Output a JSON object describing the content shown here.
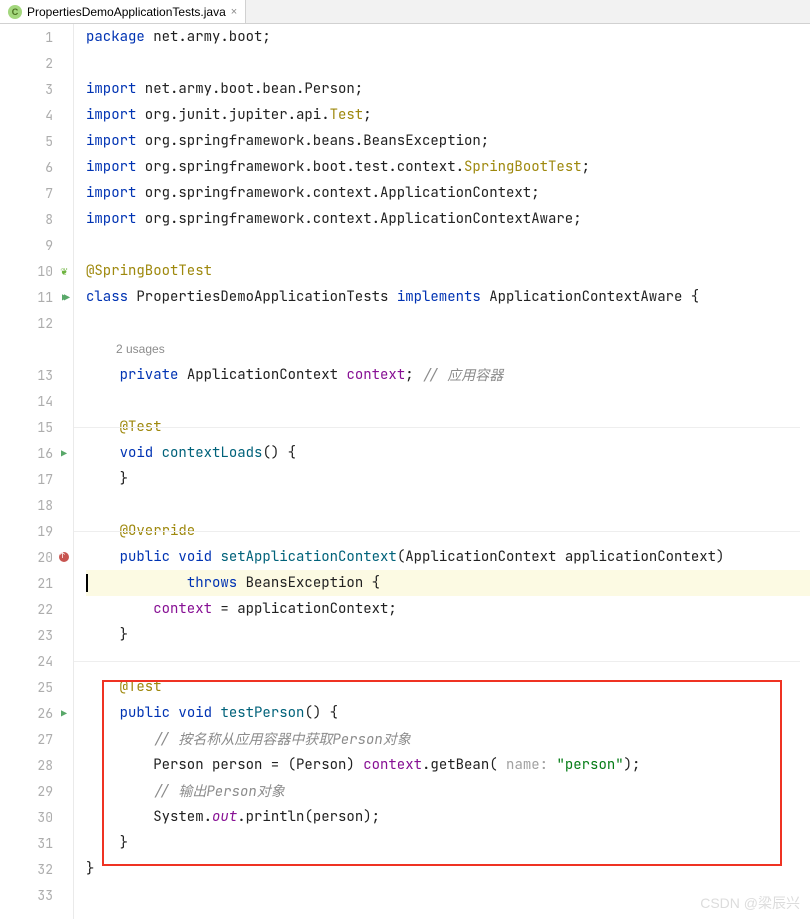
{
  "tab": {
    "filename": "PropertiesDemoApplicationTests.java",
    "close": "×"
  },
  "gutter": {
    "lines": [
      "1",
      "2",
      "3",
      "4",
      "5",
      "6",
      "7",
      "8",
      "9",
      "10",
      "11",
      "12",
      "",
      "13",
      "14",
      "15",
      "16",
      "17",
      "18",
      "19",
      "20",
      "21",
      "22",
      "23",
      "24",
      "25",
      "26",
      "27",
      "28",
      "29",
      "30",
      "31",
      "32",
      "33"
    ]
  },
  "code": {
    "l1": {
      "kw": "package",
      "rest": " net.army.boot;"
    },
    "l3": {
      "kw": "import",
      "rest": " net.army.boot.bean.Person;"
    },
    "l4": {
      "kw": "import",
      "p1": " org.junit.jupiter.api.",
      "cls": "Test",
      "semi": ";"
    },
    "l5": {
      "kw": "import",
      "rest": " org.springframework.beans.BeansException;"
    },
    "l6": {
      "kw": "import",
      "p1": " org.springframework.boot.test.context.",
      "cls": "SpringBootTest",
      "semi": ";"
    },
    "l7": {
      "kw": "import",
      "rest": " org.springframework.context.ApplicationContext;"
    },
    "l8": {
      "kw": "import",
      "rest": " org.springframework.context.ApplicationContextAware;"
    },
    "l10": {
      "ann": "@SpringBootTest"
    },
    "l11": {
      "kw1": "class",
      "name": " PropertiesDemoApplicationTests ",
      "kw2": "implements",
      "rest": " ApplicationContextAware {"
    },
    "usages": "2 usages",
    "l13": {
      "pad": "    ",
      "kw": "private",
      "sp": " ",
      "type": "ApplicationContext ",
      "field": "context",
      "semi": "; ",
      "comment": "// 应用容器"
    },
    "l15": {
      "pad": "    ",
      "ann": "@Test"
    },
    "l16": {
      "pad": "    ",
      "kw": "void",
      "sp": " ",
      "method": "contextLoads",
      "rest": "() {"
    },
    "l17": {
      "pad": "    ",
      "brace": "}"
    },
    "l19": {
      "pad": "    ",
      "ann": "@Override"
    },
    "l20": {
      "pad": "    ",
      "kw1": "public",
      "sp1": " ",
      "kw2": "void",
      "sp2": " ",
      "method": "setApplicationContext",
      "rest": "(ApplicationContext applicationContext)"
    },
    "l21": {
      "pad": "            ",
      "kw": "throws",
      "rest": " BeansException {"
    },
    "l22": {
      "pad": "        ",
      "field": "context",
      "rest": " = applicationContext;"
    },
    "l23": {
      "pad": "    ",
      "brace": "}"
    },
    "l25": {
      "pad": "    ",
      "ann": "@Test"
    },
    "l26": {
      "pad": "    ",
      "kw1": "public",
      "sp1": " ",
      "kw2": "void",
      "sp2": " ",
      "method": "testPerson",
      "rest": "() {"
    },
    "l27": {
      "pad": "        ",
      "comment": "// 按名称从应用容器中获取Person对象"
    },
    "l28": {
      "pad": "        ",
      "p1": "Person person = (Person) ",
      "field": "context",
      "dot": ".",
      "method": "getBean",
      "open": "( ",
      "hint": "name: ",
      "str": "\"person\"",
      "close": ");"
    },
    "l29": {
      "pad": "        ",
      "comment": "// 输出Person对象"
    },
    "l30": {
      "pad": "        ",
      "p1": "System.",
      "field": "out",
      "dot": ".",
      "method": "println",
      "rest": "(person);"
    },
    "l31": {
      "pad": "    ",
      "brace": "}"
    },
    "l32": {
      "brace": "}"
    }
  },
  "watermark": "CSDN @梁辰兴"
}
